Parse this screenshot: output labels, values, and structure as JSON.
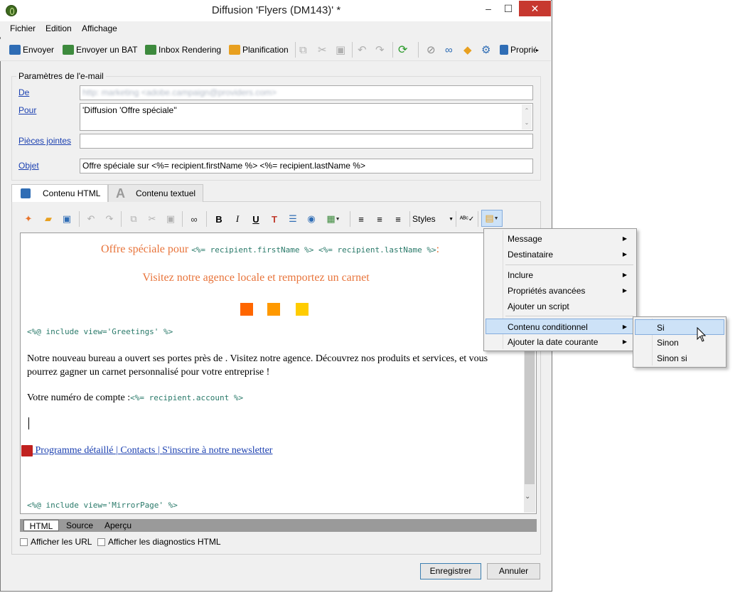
{
  "window": {
    "title": "Diffusion 'Flyers (DM143)' *",
    "controls": {
      "minimize": "–",
      "maximize": "☐",
      "close": "✕"
    }
  },
  "menubar": [
    "Fichier",
    "Edition",
    "Affichage"
  ],
  "toolbar": {
    "send": "Envoyer",
    "send_bat": "Envoyer un BAT",
    "inbox_rendering": "Inbox Rendering",
    "planning": "Planification",
    "properties": "Propriétés"
  },
  "email_params": {
    "group_title": "Paramètres de l'e-mail",
    "from_label": "De",
    "from_value": "http: marketing <adobe.campaign@providers.com>",
    "to_label": "Pour",
    "to_value": "'Diffusion 'Offre spéciale''",
    "attachments_label": "Pièces jointes",
    "attachments_value": "",
    "subject_label": "Objet",
    "subject_value": "Offre spéciale sur <%= recipient.firstName %> <%= recipient.lastName %>"
  },
  "content_tabs": {
    "html": "Contenu HTML",
    "text": "Contenu textuel"
  },
  "editor_toolbar": {
    "bold": "B",
    "italic": "I",
    "underline": "U",
    "styles": "Styles"
  },
  "editor": {
    "headline_text": "Offre spéciale pour ",
    "headline_code": "<%= recipient.firstName %> <%= recipient.lastName %>",
    "headline_end": ":",
    "subheadline": "Visitez notre agence locale et remportez un carnet",
    "squares_colors": [
      "#ff6600",
      "#ff9900",
      "#ffcc00"
    ],
    "include_greetings": "<%@ include view='Greetings' %>",
    "paragraph": "Notre nouveau bureau a ouvert ses portes près de . Visitez notre agence. Découvrez nos produits et services, et vous pourrez gagner un carnet personnalisé pour votre entreprise !",
    "account_label": "Votre numéro de compte :",
    "account_code": "<%= recipient.account %>",
    "link_program": " Programme détaillé ",
    "link_sep1": "| ",
    "link_contacts": "Contacts ",
    "link_sep2": "| ",
    "link_newsletter": "S'inscrire à notre newsletter",
    "include_mirror": "<%@ include view='MirrorPage' %>"
  },
  "view_tabs": [
    "HTML",
    "Source",
    "Aperçu"
  ],
  "options": {
    "show_urls": "Afficher les URL",
    "show_diagnostics": "Afficher les diagnostics HTML"
  },
  "buttons": {
    "save": "Enregistrer",
    "cancel": "Annuler"
  },
  "context_menu": {
    "message": "Message",
    "recipient": "Destinataire",
    "include": "Inclure",
    "advanced": "Propriétés avancées",
    "add_script": "Ajouter un script",
    "conditional": "Contenu conditionnel",
    "add_date": "Ajouter la date courante"
  },
  "submenu": {
    "if": "Si",
    "else": "Sinon",
    "elseif": "Sinon si"
  },
  "colors": {
    "accent_orange": "#e8743b",
    "link_blue": "#1a3fb0",
    "code_green": "#2a7a6a",
    "highlight": "#cde2f7"
  }
}
